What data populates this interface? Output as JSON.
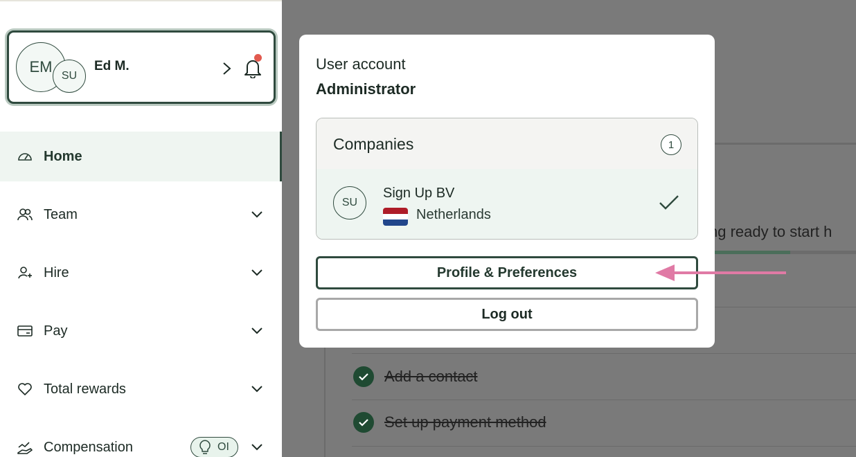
{
  "user": {
    "initials": "EM",
    "company_initials": "SU",
    "name": "Ed M."
  },
  "nav": {
    "items": [
      {
        "label": "Home",
        "icon": "dashboard-gauge-icon",
        "active": true
      },
      {
        "label": "Team",
        "icon": "people-icon"
      },
      {
        "label": "Hire",
        "icon": "add-person-icon"
      },
      {
        "label": "Pay",
        "icon": "credit-card-icon"
      },
      {
        "label": "Total rewards",
        "icon": "heart-icon"
      },
      {
        "label": "Compensation",
        "icon": "chart-hand-icon",
        "badge": "OI"
      }
    ]
  },
  "background": {
    "onboarding_text": "ng ready to start h",
    "progress_fraction": 0.54,
    "tasks": [
      "Add a contact",
      "Set up payment method"
    ]
  },
  "popover": {
    "title": "User account",
    "role": "Administrator",
    "companies_label": "Companies",
    "companies_count": "1",
    "company": {
      "initials": "SU",
      "name": "Sign Up BV",
      "country": "Netherlands"
    },
    "profile_button": "Profile & Preferences",
    "logout_button": "Log out"
  },
  "colors": {
    "brand_dark": "#2f4a3e",
    "active_bg": "#eff5f1",
    "notification_dot": "#e25a4f",
    "arrow": "#e07aa5",
    "overlay": "#7a7a7a"
  }
}
